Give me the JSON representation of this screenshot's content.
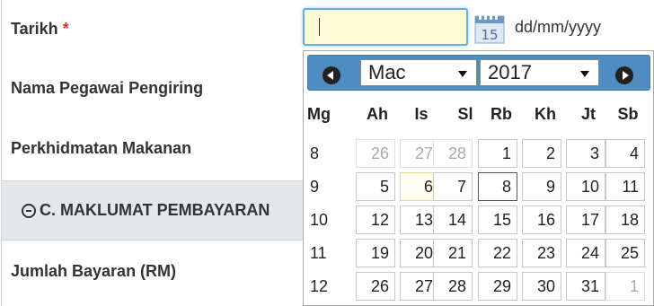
{
  "form": {
    "date_label": "Tarikh",
    "required_mark": "*",
    "officer_label": "Nama Pegawai Pengiring",
    "food_label": "Perkhidmatan Makanan",
    "section_title": "C. MAKLUMAT PEMBAYARAN",
    "amount_label": "Jumlah Bayaran (RM)"
  },
  "date_input": {
    "value": "",
    "format_hint": "dd/mm/yyyy",
    "calendar_icon_day": "15"
  },
  "calendar": {
    "month": "Mac",
    "year": "2017",
    "weekdays": [
      "Mg",
      "Ah",
      "Is",
      "Sl",
      "Rb",
      "Kh",
      "Jt",
      "Sb"
    ],
    "weeks": [
      {
        "week": "8",
        "days": [
          "26",
          "27",
          "28",
          "1",
          "2",
          "3",
          "4"
        ]
      },
      {
        "week": "9",
        "days": [
          "5",
          "6",
          "7",
          "8",
          "9",
          "10",
          "11"
        ]
      },
      {
        "week": "10",
        "days": [
          "12",
          "13",
          "14",
          "15",
          "16",
          "17",
          "18"
        ]
      },
      {
        "week": "11",
        "days": [
          "19",
          "20",
          "21",
          "22",
          "23",
          "24",
          "25"
        ]
      },
      {
        "week": "12",
        "days": [
          "26",
          "27",
          "28",
          "29",
          "30",
          "31",
          "1"
        ]
      }
    ],
    "other_month": [
      [
        0,
        0
      ],
      [
        0,
        1
      ],
      [
        0,
        2
      ],
      [
        4,
        6
      ]
    ],
    "today": [
      1,
      1
    ],
    "selected": [
      1,
      3
    ]
  }
}
